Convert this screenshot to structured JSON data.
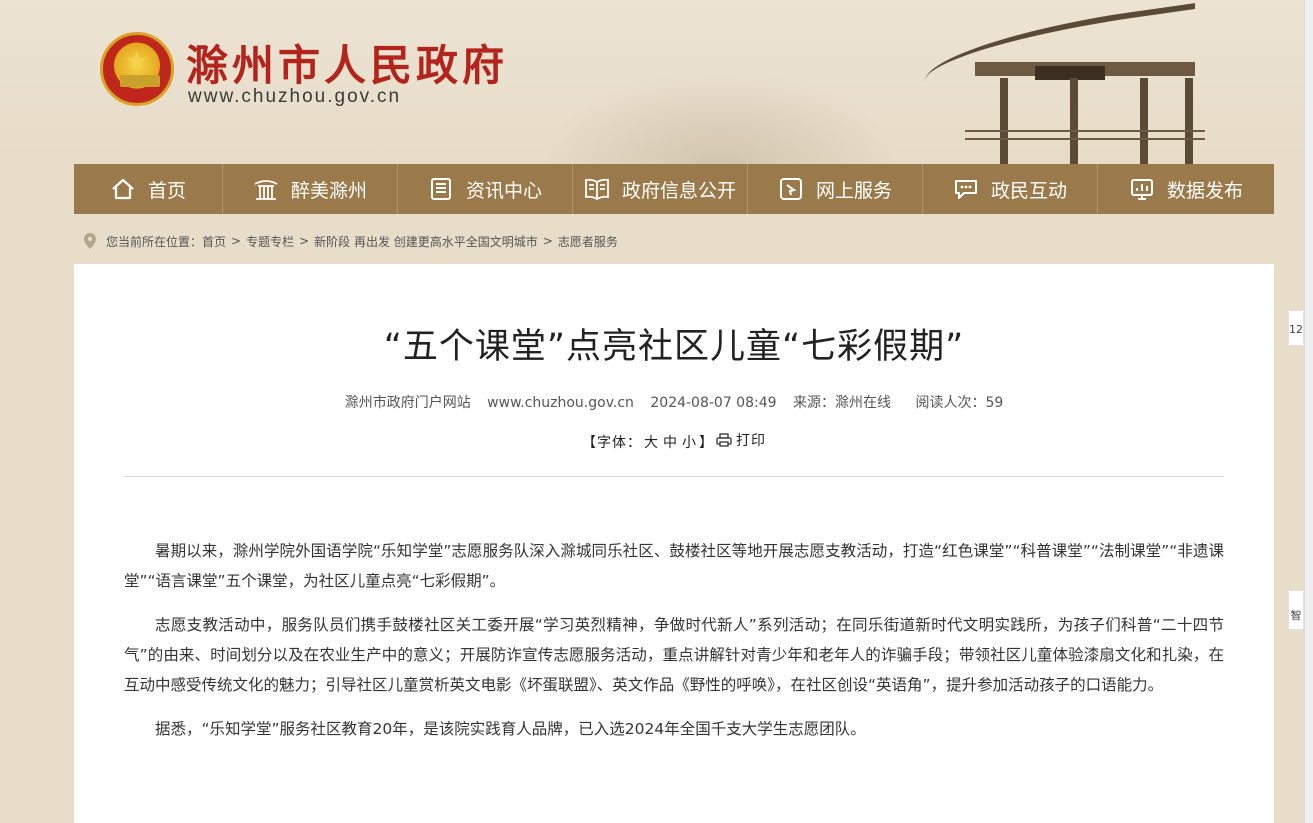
{
  "header": {
    "site_title": "滁州市人民政府",
    "site_url": "www.chuzhou.gov.cn"
  },
  "nav": [
    {
      "label": "首页",
      "icon": "home-icon"
    },
    {
      "label": "醉美滁州",
      "icon": "pavilion-icon"
    },
    {
      "label": "资讯中心",
      "icon": "news-icon"
    },
    {
      "label": "政府信息公开",
      "icon": "book-icon"
    },
    {
      "label": "网上服务",
      "icon": "service-icon"
    },
    {
      "label": "政民互动",
      "icon": "chat-icon"
    },
    {
      "label": "数据发布",
      "icon": "chart-icon"
    }
  ],
  "breadcrumb": {
    "prefix": "您当前所在位置：",
    "items": [
      "首页",
      "专题专栏",
      "新阶段 再出发 创建更高水平全国文明城市",
      "志愿者服务"
    ],
    "separator": ">"
  },
  "article": {
    "title": "“五个课堂”点亮社区儿童“七彩假期”",
    "meta": {
      "site": "滁州市政府门户网站",
      "url": "www.chuzhou.gov.cn",
      "datetime": "2024-08-07 08:49",
      "source": "来源：滁州在线",
      "reads": "阅读人次：59"
    },
    "tools": {
      "font_prefix": "【字体：",
      "large": "大",
      "medium": "中",
      "small": "小",
      "font_suffix": "】",
      "print": "打印"
    },
    "paragraphs": [
      "暑期以来，滁州学院外国语学院“乐知学堂”志愿服务队深入滁城同乐社区、鼓楼社区等地开展志愿支教活动，打造“红色课堂”“科普课堂”“法制课堂”“非遗课堂”“语言课堂”五个课堂，为社区儿童点亮“七彩假期”。",
      "志愿支教活动中，服务队员们携手鼓楼社区关工委开展“学习英烈精神，争做时代新人”系列活动；在同乐街道新时代文明实践所，为孩子们科普“二十四节气”的由来、时间划分以及在农业生产中的意义；开展防诈宣传志愿服务活动，重点讲解针对青少年和老年人的诈骗手段；带领社区儿童体验漆扇文化和扎染，在互动中感受传统文化的魅力；引导社区儿童赏析英文电影《坏蛋联盟》、英文作品《野性的呼唤》，在社区创设“英语角”，提升参加活动孩子的口语能力。",
      "据悉，“乐知学堂”服务社区教育20年，是该院实践育人品牌，已入选2024年全国千支大学生志愿团队。"
    ]
  },
  "side_tabs": [
    "12",
    "智"
  ],
  "colors": {
    "brand_red": "#b3241d",
    "nav_bg": "#9a7a4a",
    "page_bg": "#e8ddc9"
  }
}
